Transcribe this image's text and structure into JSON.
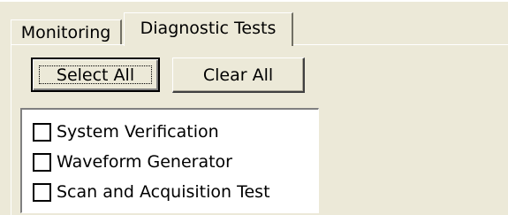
{
  "tabs": [
    {
      "label": "Monitoring",
      "active": false
    },
    {
      "label": "Diagnostic Tests",
      "active": true
    }
  ],
  "buttons": {
    "select_all": "Select All",
    "clear_all": "Clear All"
  },
  "tests": [
    {
      "label": "System Verification",
      "checked": false
    },
    {
      "label": "Waveform Generator",
      "checked": false
    },
    {
      "label": "Scan and Acquisition Test",
      "checked": false
    }
  ]
}
